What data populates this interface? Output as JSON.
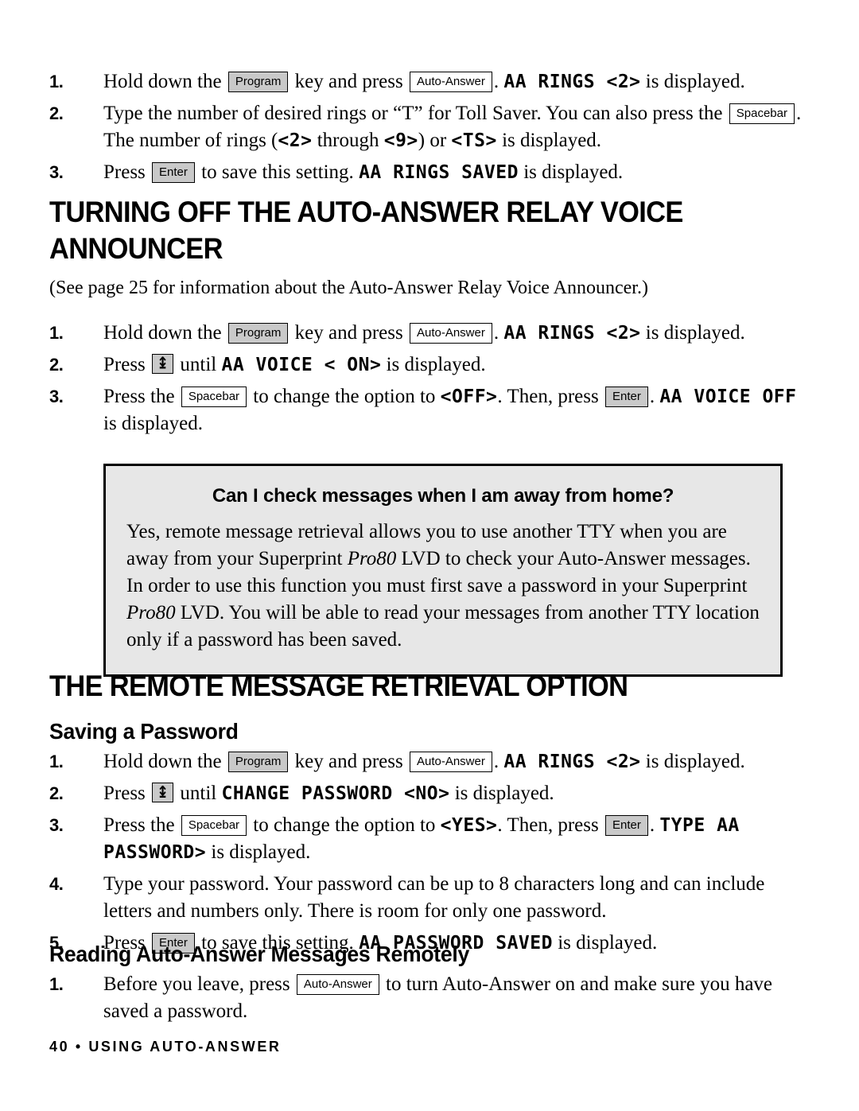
{
  "colors": {
    "text": "#000000",
    "page_bg": "#ffffff",
    "key_gray": "#c9c9c9",
    "key_white": "#ffffff",
    "callout_bg": "#e7e7e7",
    "callout_border": "#000000"
  },
  "keys": {
    "program": "Program",
    "auto_answer": "Auto-Answer",
    "spacebar": "Spacebar",
    "enter": "Enter",
    "down_arrow_glyph": "↨"
  },
  "section_a": {
    "steps": [
      {
        "num": "1.",
        "parts": [
          {
            "t": "text",
            "v": "Hold down the "
          },
          {
            "t": "key_gray",
            "v": "Program"
          },
          {
            "t": "text",
            "v": " key and press "
          },
          {
            "t": "key_white",
            "v": "Auto-Answer"
          },
          {
            "t": "text",
            "v": ". "
          },
          {
            "t": "lcd",
            "v": "AA RINGS <2>"
          },
          {
            "t": "text",
            "v": " is displayed."
          }
        ]
      },
      {
        "num": "2.",
        "parts": [
          {
            "t": "text",
            "v": "Type the number of desired rings or “T” for Toll Saver. You can also press the "
          },
          {
            "t": "key_white",
            "v": "Spacebar"
          },
          {
            "t": "text",
            "v": ". The number of rings ("
          },
          {
            "t": "lcd",
            "v": "<2>"
          },
          {
            "t": "text",
            "v": " through "
          },
          {
            "t": "lcd",
            "v": "<9>"
          },
          {
            "t": "text",
            "v": ") or "
          },
          {
            "t": "lcd",
            "v": "<TS>"
          },
          {
            "t": "text",
            "v": " is displayed."
          }
        ]
      },
      {
        "num": "3.",
        "parts": [
          {
            "t": "text",
            "v": "Press "
          },
          {
            "t": "key_gray",
            "v": "Enter"
          },
          {
            "t": "text",
            "v": " to save this setting. "
          },
          {
            "t": "lcd",
            "v": "AA RINGS SAVED"
          },
          {
            "t": "text",
            "v": " is displayed."
          }
        ]
      }
    ]
  },
  "heading_1": "TURNING OFF THE AUTO-ANSWER RELAY VOICE ANNOUNCER",
  "note_1": "(See page 25 for information about the Auto-Answer Relay Voice Announcer.)",
  "section_b": {
    "steps": [
      {
        "num": "1.",
        "parts": [
          {
            "t": "text",
            "v": "Hold down the "
          },
          {
            "t": "key_gray",
            "v": "Program"
          },
          {
            "t": "text",
            "v": " key and press "
          },
          {
            "t": "key_white",
            "v": "Auto-Answer"
          },
          {
            "t": "text",
            "v": ". "
          },
          {
            "t": "lcd",
            "v": "AA RINGS <2>"
          },
          {
            "t": "text",
            "v": " is displayed."
          }
        ]
      },
      {
        "num": "2.",
        "parts": [
          {
            "t": "text",
            "v": "Press "
          },
          {
            "t": "key_arrow",
            "v": "↨"
          },
          {
            "t": "text",
            "v": " until "
          },
          {
            "t": "lcd",
            "v": "AA VOICE < ON>"
          },
          {
            "t": "text",
            "v": " is displayed."
          }
        ]
      },
      {
        "num": "3.",
        "parts": [
          {
            "t": "text",
            "v": "Press the "
          },
          {
            "t": "key_white",
            "v": "Spacebar"
          },
          {
            "t": "text",
            "v": " to change the option to "
          },
          {
            "t": "lcd",
            "v": "<OFF>"
          },
          {
            "t": "text",
            "v": ". Then, press "
          },
          {
            "t": "key_gray",
            "v": "Enter"
          },
          {
            "t": "text",
            "v": ". "
          },
          {
            "t": "lcd",
            "v": "AA VOICE OFF"
          },
          {
            "t": "text",
            "v": " is displayed."
          }
        ]
      }
    ]
  },
  "callout": {
    "question": "Can I check messages when I am away from home?",
    "answer_parts": [
      {
        "t": "text",
        "v": "Yes, remote message retrieval allows you to use another TTY when you are away from your Superprint "
      },
      {
        "t": "italic",
        "v": "Pro80"
      },
      {
        "t": "text",
        "v": " LVD to check your Auto-Answer messages. In order to use this function you must first save a password in your Superprint "
      },
      {
        "t": "italic",
        "v": "Pro80"
      },
      {
        "t": "text",
        "v": " LVD. You will be able to read your messages from another TTY location only if a password has been saved."
      }
    ]
  },
  "heading_2": "THE REMOTE MESSAGE RETRIEVAL OPTION",
  "subheading_1": "Saving a Password",
  "section_c": {
    "steps": [
      {
        "num": "1.",
        "parts": [
          {
            "t": "text",
            "v": "Hold down the "
          },
          {
            "t": "key_gray",
            "v": "Program"
          },
          {
            "t": "text",
            "v": " key and press "
          },
          {
            "t": "key_white",
            "v": "Auto-Answer"
          },
          {
            "t": "text",
            "v": ". "
          },
          {
            "t": "lcd",
            "v": "AA RINGS <2>"
          },
          {
            "t": "text",
            "v": " is displayed."
          }
        ]
      },
      {
        "num": "2.",
        "parts": [
          {
            "t": "text",
            "v": "Press "
          },
          {
            "t": "key_arrow",
            "v": "↨"
          },
          {
            "t": "text",
            "v": " until "
          },
          {
            "t": "lcd",
            "v": "CHANGE PASSWORD <NO>"
          },
          {
            "t": "text",
            "v": " is displayed."
          }
        ]
      },
      {
        "num": "3.",
        "parts": [
          {
            "t": "text",
            "v": "Press the "
          },
          {
            "t": "key_white",
            "v": "Spacebar"
          },
          {
            "t": "text",
            "v": " to change the option to "
          },
          {
            "t": "lcd",
            "v": "<YES>"
          },
          {
            "t": "text",
            "v": ". Then, press "
          },
          {
            "t": "key_gray",
            "v": "Enter"
          },
          {
            "t": "text",
            "v": ". "
          },
          {
            "t": "lcd",
            "v": "TYPE AA PASSWORD>"
          },
          {
            "t": "text",
            "v": " is displayed."
          }
        ]
      },
      {
        "num": "4.",
        "parts": [
          {
            "t": "text",
            "v": "Type your password. Your password can be up to 8 characters long and can include letters and numbers only. There is room for only one password."
          }
        ]
      },
      {
        "num": "5.",
        "parts": [
          {
            "t": "text",
            "v": "Press "
          },
          {
            "t": "key_gray",
            "v": "Enter"
          },
          {
            "t": "text",
            "v": " to save this setting. "
          },
          {
            "t": "lcd",
            "v": "AA PASSWORD SAVED"
          },
          {
            "t": "text",
            "v": " is displayed."
          }
        ]
      }
    ]
  },
  "subheading_2": "Reading Auto-Answer Messages Remotely",
  "section_d": {
    "steps": [
      {
        "num": "1.",
        "parts": [
          {
            "t": "text",
            "v": "Before you leave, press "
          },
          {
            "t": "key_white",
            "v": "Auto-Answer"
          },
          {
            "t": "text",
            "v": " to turn Auto-Answer on and make sure you have saved a password."
          }
        ]
      }
    ]
  },
  "footer": "40 • USING AUTO-ANSWER"
}
